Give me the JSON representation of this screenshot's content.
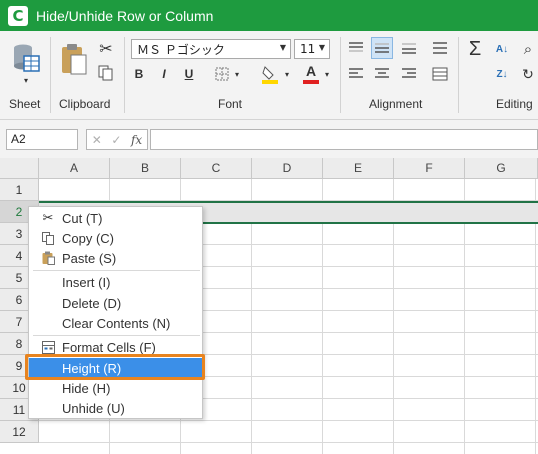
{
  "window": {
    "title": "Hide/Unhide Row or Column",
    "logo_letter": "C"
  },
  "ribbon": {
    "groups": {
      "sheet": "Sheet",
      "clipboard": "Clipboard",
      "font": "Font",
      "alignment": "Alignment",
      "editing": "Editing"
    },
    "font_name": "ＭＳ Ｐゴシック",
    "font_size": "11",
    "bold_label": "B",
    "italic_label": "I",
    "underline_label": "U",
    "font_color_label": "A",
    "sum_symbol": "Σ",
    "colors": {
      "fill_color": "#ffd700",
      "font_color": "#e02020"
    }
  },
  "formula_bar": {
    "name_box": "A2",
    "fx_label": "fx",
    "formula": ""
  },
  "grid": {
    "columns": [
      "A",
      "B",
      "C",
      "D",
      "E",
      "F",
      "G"
    ],
    "rows": [
      "1",
      "2",
      "3",
      "4",
      "5",
      "6",
      "7",
      "8",
      "9",
      "10",
      "11",
      "12"
    ],
    "selected_row": "2"
  },
  "context_menu": {
    "items": [
      {
        "label": "Cut (T)",
        "icon": "scissors-icon"
      },
      {
        "label": "Copy (C)",
        "icon": "copy-icon"
      },
      {
        "label": "Paste (S)",
        "icon": "paste-icon"
      },
      {
        "label": "Insert (I)"
      },
      {
        "label": "Delete (D)"
      },
      {
        "label": "Clear Contents (N)"
      },
      {
        "label": "Format Cells (F)",
        "icon": "format-cells-icon"
      },
      {
        "label": "Height (R)",
        "highlighted": true
      },
      {
        "label": "Hide (H)"
      },
      {
        "label": "Unhide (U)"
      }
    ],
    "colors": {
      "highlight": "#3b8fe8",
      "callout_frame": "#e8841f"
    }
  },
  "colors": {
    "titlebar": "#1e9b3f",
    "selection_border": "#217346"
  }
}
